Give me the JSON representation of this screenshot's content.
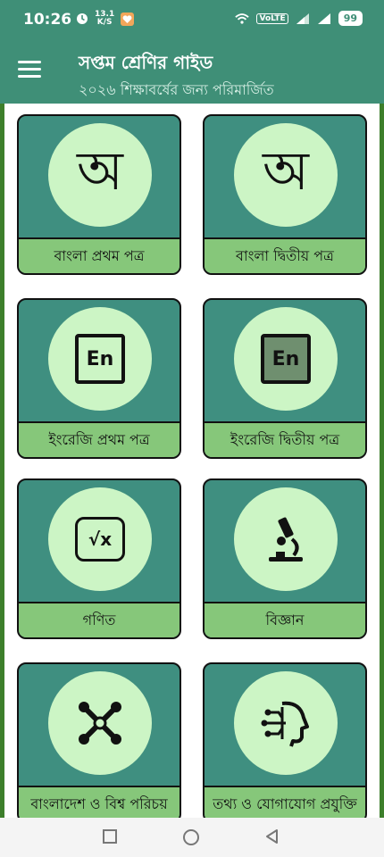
{
  "status": {
    "time": "10:26",
    "speed_top": "13.1",
    "speed_bottom": "K/S",
    "volte": "VoLTE",
    "battery": "99"
  },
  "app": {
    "title": "সপ্তম শ্রেণির গাইড",
    "subtitle": "২০২৬ শিক্ষাবর্ষের জন্য পরিমার্জিত"
  },
  "subjects": [
    {
      "label": "বাংলা প্রথম পত্র",
      "icon": "bangla-letter-icon",
      "glyph": "অ"
    },
    {
      "label": "বাংলা দ্বিতীয় পত্র",
      "icon": "bangla-letter-icon",
      "glyph": "অ"
    },
    {
      "label": "ইংরেজি প্রথম পত্র",
      "icon": "english-en-icon",
      "glyph": "En"
    },
    {
      "label": "ইংরেজি দ্বিতীয় পত্র",
      "icon": "english-en-icon",
      "glyph": "En"
    },
    {
      "label": "গণিত",
      "icon": "square-root-icon",
      "glyph": "√x"
    },
    {
      "label": "বিজ্ঞান",
      "icon": "microscope-icon"
    },
    {
      "label": "বাংলাদেশ ও বিশ্ব পরিচয়",
      "icon": "joomla-globe-icon"
    },
    {
      "label": "তথ্য ও যোগাযোগ প্রযুক্তি",
      "icon": "ai-head-circuit-icon"
    }
  ],
  "colors": {
    "appbar": "#3f8f77",
    "card": "#3f8f80",
    "circle": "#ccf5c5",
    "label_bg": "#86c77a",
    "frame": "#3d7f2b"
  },
  "navbar": {
    "icons": [
      "square-recents-icon",
      "circle-home-icon",
      "triangle-back-icon"
    ]
  }
}
